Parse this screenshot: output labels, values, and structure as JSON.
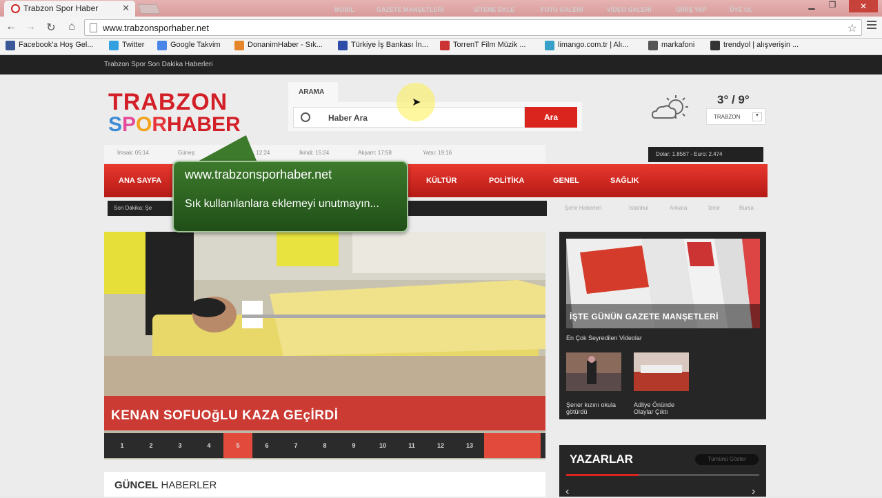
{
  "browser": {
    "tab_title": "Trabzon Spor Haber",
    "url": "www.trabzonsporhaber.net",
    "bookmarks": [
      {
        "label": "Facebook'a Hoş Gel...",
        "color": "#3b5998"
      },
      {
        "label": "Twitter",
        "color": "#33a0e0"
      },
      {
        "label": "Google Takvim",
        "color": "#4a86e8"
      },
      {
        "label": "DonanimHaber - Sık...",
        "color": "#e6862a"
      },
      {
        "label": "Türkiye İş Bankası İn...",
        "color": "#2d4da8"
      },
      {
        "label": "TorrenT Film Müzik ...",
        "color": "#cc3333"
      },
      {
        "label": "limango.com.tr | Alı...",
        "color": "#37a0c8"
      },
      {
        "label": "markafoni",
        "color": "#555555"
      },
      {
        "label": "trendyol | alışverişin ...",
        "color": "#333333"
      }
    ]
  },
  "site": {
    "tagline": "Trabzon Spor Son Dakika Haberleri",
    "topnav": [
      "MOBİL",
      "GAZETE MANŞETLERİ",
      "SİTENE EKLE",
      "FOTO GALERİ",
      "VİDEO GALERİ",
      "GİRİŞ YAP",
      "ÜYE OL"
    ],
    "logo_line1": "TRABZON",
    "logo_line2": {
      "s": "S",
      "p": "P",
      "o": "O",
      "r": "R",
      "haber": "HABER"
    },
    "search": {
      "tab": "ARAMA",
      "placeholder": "Haber Ara",
      "button": "Ara"
    },
    "weather": {
      "temp": "3° / 9°",
      "city": "TRABZON"
    },
    "prayer_times": [
      "İmsak: 05:14",
      "Güneş:",
      "Öğle: 12:24",
      "İkindi: 15:24",
      "Akşam: 17:58",
      "Yatsı: 19:16"
    ],
    "currency": "Dolar: 1.8567 - Euro: 2.474",
    "mainnav": [
      "ANA SAYFA",
      "KÜLTÜR",
      "POLİTİKA",
      "GENEL",
      "SAĞLIK"
    ],
    "breaking": "Son Dakika:  Şe",
    "cities": [
      "Şehir Haberleri",
      "İstanbul",
      "Ankara",
      "İzmir",
      "Bursa"
    ],
    "overlay": {
      "line1": "www.trabzonsporhaber.net",
      "line2": "Sık kullanılanlara eklemeyi unutmayın..."
    },
    "slider": {
      "title": "KENAN SOFUOğLU KAZA GEçİRDİ",
      "pages": [
        "1",
        "2",
        "3",
        "4",
        "5",
        "6",
        "7",
        "8",
        "9",
        "10",
        "11",
        "12",
        "13"
      ],
      "active_page": "5"
    },
    "gundem": {
      "bold": "GÜNCEL",
      "rest": " HABERLER"
    },
    "sidebar": {
      "gazete_title": "İŞTE GÜNÜN GAZETE MANŞETLERİ",
      "videos_title": "En Çok Seyredilen Videolar",
      "videos": [
        {
          "caption": "Şener kızını okula götürdü"
        },
        {
          "caption": "Adliye Önünde Olaylar Çıktı"
        }
      ],
      "yazarlar": "YAZARLAR",
      "tumu": "Tümünü Göster"
    }
  },
  "colors": {
    "accent": "#d9251d",
    "dark": "#222222",
    "overlay_green": "#2f6a22"
  }
}
